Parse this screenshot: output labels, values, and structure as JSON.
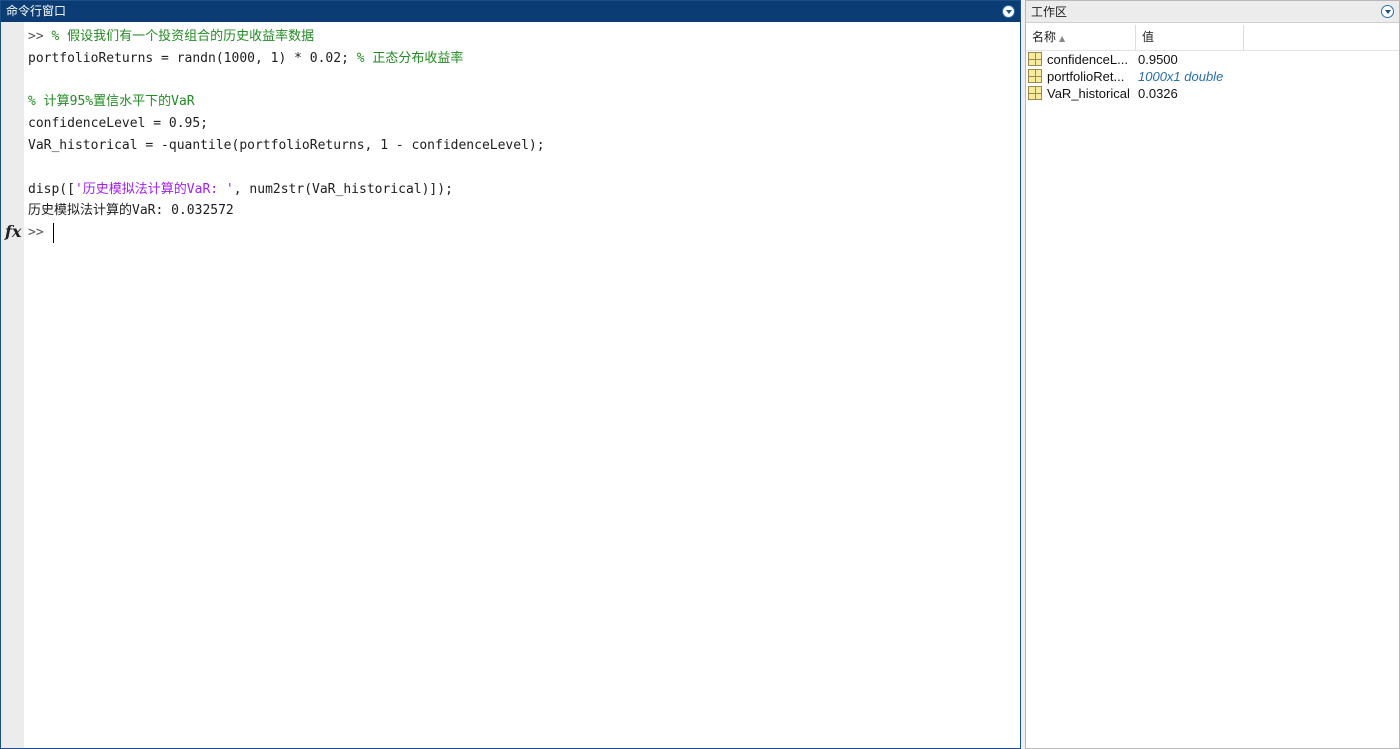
{
  "command_window": {
    "title": "命令行窗口",
    "fx_label": "fx",
    "lines": [
      {
        "prompt": ">> ",
        "code": "",
        "comment": "% 假设我们有一个投资组合的历史收益率数据",
        "str": "",
        "tail": ""
      },
      {
        "prompt": "",
        "code": "portfolioReturns = randn(1000, 1) * 0.02; ",
        "comment": "% 正态分布收益率",
        "str": "",
        "tail": ""
      },
      {
        "prompt": "",
        "code": "",
        "comment": "",
        "str": "",
        "tail": ""
      },
      {
        "prompt": "",
        "code": "",
        "comment": "% 计算95%置信水平下的VaR",
        "str": "",
        "tail": ""
      },
      {
        "prompt": "",
        "code": "confidenceLevel = 0.95;",
        "comment": "",
        "str": "",
        "tail": ""
      },
      {
        "prompt": "",
        "code": "VaR_historical = -quantile(portfolioReturns, 1 - confidenceLevel);",
        "comment": "",
        "str": "",
        "tail": ""
      },
      {
        "prompt": "",
        "code": "",
        "comment": "",
        "str": "",
        "tail": ""
      },
      {
        "prompt": "",
        "code": "disp([",
        "comment": "",
        "str": "'历史模拟法计算的VaR: '",
        "tail": ", num2str(VaR_historical)]);"
      },
      {
        "prompt": "",
        "code": "历史模拟法计算的VaR: 0.032572",
        "comment": "",
        "str": "",
        "tail": ""
      }
    ],
    "input_prompt": ">> "
  },
  "workspace": {
    "title": "工作区",
    "columns": {
      "name": "名称",
      "value": "值"
    },
    "variables": [
      {
        "name": "confidenceL...",
        "value": "0.9500",
        "italic": false
      },
      {
        "name": "portfolioRet...",
        "value": "1000x1 double",
        "italic": true
      },
      {
        "name": "VaR_historical",
        "value": "0.0326",
        "italic": false
      }
    ]
  },
  "colors": {
    "title_bar": "#0b3c74",
    "comment": "#228b22",
    "string": "#a020f0",
    "italic_value": "#2a6ea8"
  }
}
